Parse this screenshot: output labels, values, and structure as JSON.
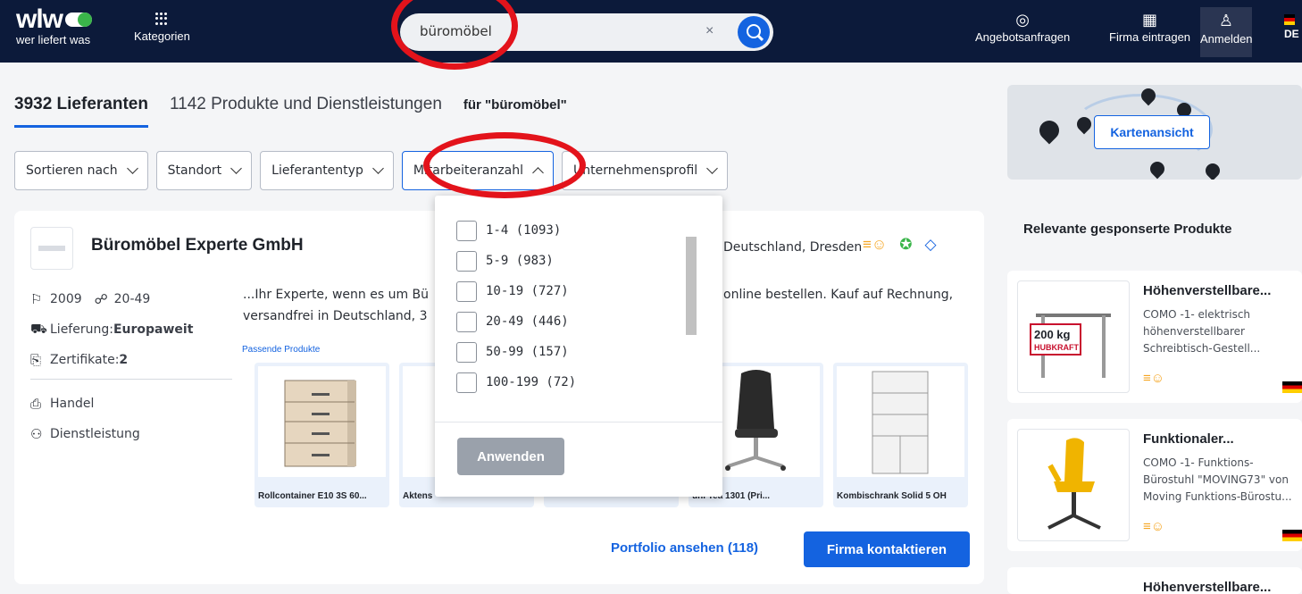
{
  "header": {
    "logo_text": "wlw",
    "logo_sub": "wer liefert was",
    "categories_label": "Kategorien",
    "search_value": "büromöbel",
    "clear_symbol": "×",
    "nav": [
      {
        "label": "Angebotsanfragen",
        "icon": "target-icon"
      },
      {
        "label": "Firma eintragen",
        "icon": "building-icon"
      },
      {
        "label": "Anmelden",
        "icon": "user-icon"
      }
    ],
    "language": "DE"
  },
  "tabs": {
    "suppliers": "3932 Lieferanten",
    "products": "1142 Produkte und Dienstleistungen",
    "query": "für \"büromöbel\""
  },
  "filters": [
    "Sortieren nach",
    "Standort",
    "Lieferantentyp",
    "Mitarbeiteranzahl",
    "Unternehmensprofil"
  ],
  "dropdown": {
    "options": [
      "1-4 (1093)",
      "5-9 (983)",
      "10-19 (727)",
      "20-49 (446)",
      "50-99 (157)",
      "100-199 (72)"
    ],
    "apply_label": "Anwenden"
  },
  "result": {
    "name": "Büromöbel Experte GmbH",
    "location": "Deutschland, Dresden",
    "founded": "2009",
    "employees": "20-49",
    "delivery_label": "Lieferung: ",
    "delivery_value": "Europaweit",
    "certificates_label": "Zertifikate: ",
    "certificates_value": "2",
    "type_1": "Handel",
    "type_2": "Dienstleistung",
    "description_1": "...Ihr Experte, wenn es um Bü",
    "description_2": "versandfrei in Deutschland, 3",
    "description_tail": "online bestellen. Kauf auf Rechnung,",
    "products_label": "Passende Produkte",
    "products": [
      "Rollcontainer E10 3S 60...",
      "Aktens",
      "",
      "uhl Tea 1301 (Pri...",
      "Kombischrank Solid 5 OH"
    ],
    "portfolio_label": "Portfolio ansehen (118)",
    "contact_label": "Firma kontaktieren"
  },
  "map": {
    "button_label": "Kartenansicht"
  },
  "sponsored": {
    "title": "Relevante gesponserte Produkte",
    "items": [
      {
        "title": "Höhenverstellbare...",
        "desc": "COMO -1- elektrisch höhenverstellbarer Schreibtisch-Gestell...",
        "img_text_1": "200 kg",
        "img_text_2": "HUBKRAFT"
      },
      {
        "title": "Funktionaler...",
        "desc": "COMO -1- Funktions-Bürostuhl \"MOVING73\" von Moving Funktions-Bürostu..."
      },
      {
        "title": "Höhenverstellbare..."
      }
    ]
  },
  "colors": {
    "brand_blue": "#1463e0",
    "header_bg": "#0c1a3a",
    "annotation_red": "#e3131b"
  }
}
